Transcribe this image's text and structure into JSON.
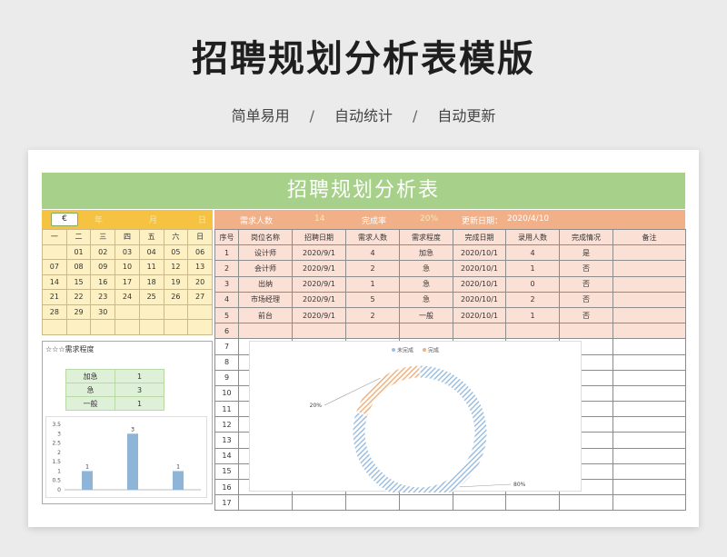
{
  "hero": {
    "title": "招聘规划分析表模版",
    "tag1": "简单易用",
    "tag2": "自动统计",
    "tag3": "自动更新",
    "sep": "/"
  },
  "sheet": {
    "banner": "招聘规划分析表",
    "calendar": {
      "icon_text": "€",
      "header_slots": [
        "年",
        "月",
        "日"
      ],
      "weekdays": [
        "一",
        "二",
        "三",
        "四",
        "五",
        "六",
        "日"
      ],
      "weeks": [
        [
          "",
          "01",
          "02",
          "03",
          "04",
          "05",
          "06"
        ],
        [
          "07",
          "08",
          "09",
          "10",
          "11",
          "12",
          "13"
        ],
        [
          "14",
          "15",
          "16",
          "17",
          "18",
          "19",
          "20"
        ],
        [
          "21",
          "22",
          "23",
          "24",
          "25",
          "26",
          "27"
        ],
        [
          "28",
          "29",
          "30",
          "",
          "",
          "",
          ""
        ],
        [
          "",
          "",
          "",
          "",
          "",
          "",
          ""
        ]
      ]
    },
    "info": {
      "need_label": "需求人数",
      "need_value": "14",
      "rate_label": "完成率",
      "rate_value": "20%",
      "update_label": "更新日期：",
      "update_value": "2020/4/10"
    },
    "table": {
      "headers": [
        "序号",
        "岗位名称",
        "招聘日期",
        "需求人数",
        "需求程度",
        "完成日期",
        "录用人数",
        "完成情况",
        "备注"
      ],
      "rows": [
        [
          "1",
          "设计师",
          "2020/9/1",
          "4",
          "加急",
          "2020/10/1",
          "4",
          "是",
          ""
        ],
        [
          "2",
          "会计师",
          "2020/9/1",
          "2",
          "急",
          "2020/10/1",
          "1",
          "否",
          ""
        ],
        [
          "3",
          "出纳",
          "2020/9/1",
          "1",
          "急",
          "2020/10/1",
          "0",
          "否",
          ""
        ],
        [
          "4",
          "市场经理",
          "2020/9/1",
          "5",
          "急",
          "2020/10/1",
          "2",
          "否",
          ""
        ],
        [
          "5",
          "前台",
          "2020/9/1",
          "2",
          "一般",
          "2020/10/1",
          "1",
          "否",
          ""
        ],
        [
          "6",
          "",
          "",
          "",
          "",
          "",
          "",
          "",
          ""
        ],
        [
          "7",
          "",
          "",
          "",
          "",
          "",
          "",
          "",
          ""
        ],
        [
          "8",
          "",
          "",
          "",
          "",
          "",
          "",
          "",
          ""
        ],
        [
          "9",
          "",
          "",
          "",
          "",
          "",
          "",
          "",
          ""
        ],
        [
          "10",
          "",
          "",
          "",
          "",
          "",
          "",
          "",
          ""
        ],
        [
          "11",
          "",
          "",
          "",
          "",
          "",
          "",
          "",
          ""
        ],
        [
          "12",
          "",
          "",
          "",
          "",
          "",
          "",
          "",
          ""
        ],
        [
          "13",
          "",
          "",
          "",
          "",
          "",
          "",
          "",
          ""
        ],
        [
          "14",
          "",
          "",
          "",
          "",
          "",
          "",
          "",
          ""
        ],
        [
          "15",
          "",
          "",
          "",
          "",
          "",
          "",
          "",
          ""
        ],
        [
          "16",
          "",
          "",
          "",
          "",
          "",
          "",
          "",
          ""
        ],
        [
          "17",
          "",
          "",
          "",
          "",
          "",
          "",
          "",
          ""
        ]
      ]
    },
    "urgency": {
      "title": "☆☆☆需求程度",
      "rows": [
        [
          "加急",
          "1"
        ],
        [
          "急",
          "3"
        ],
        [
          "一般",
          "1"
        ]
      ]
    }
  },
  "chart_data": [
    {
      "type": "bar",
      "categories": [
        "加急",
        "急",
        "一般"
      ],
      "values": [
        1,
        3,
        1
      ],
      "ylim": [
        0,
        3.5
      ],
      "yticks": [
        "0",
        "0.5",
        "1",
        "1.5",
        "2",
        "2.5",
        "3",
        "3.5"
      ],
      "color": "#8eb4d8"
    },
    {
      "type": "pie",
      "donut": true,
      "legend_position": "top",
      "labels": [
        "未完成",
        "完成"
      ],
      "values": [
        80,
        20
      ],
      "value_labels": [
        "80%",
        "20%"
      ],
      "colors": [
        "#9dbfe0",
        "#f0b27f"
      ]
    }
  ]
}
